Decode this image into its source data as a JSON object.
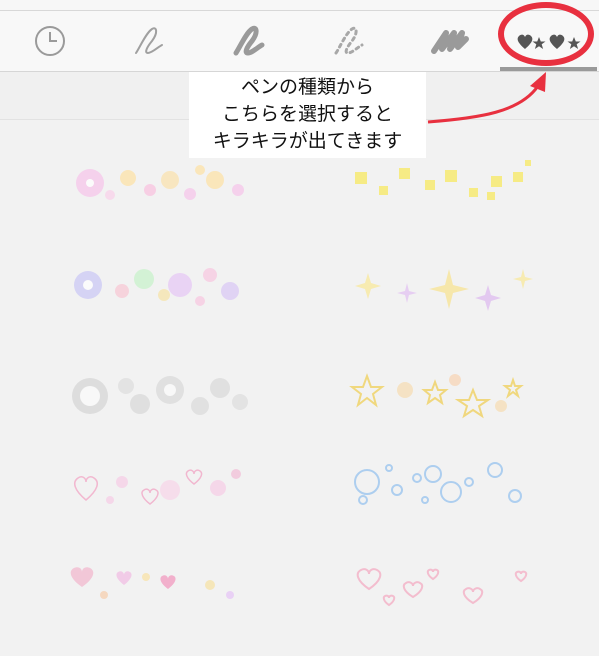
{
  "toolbar": {
    "tools": [
      {
        "icon": "clock-icon",
        "label": "history"
      },
      {
        "icon": "pen-icon",
        "label": "pen"
      },
      {
        "icon": "marker-icon",
        "label": "marker"
      },
      {
        "icon": "dotted-pen-icon",
        "label": "dotted pen"
      },
      {
        "icon": "brush-icon",
        "label": "brush"
      },
      {
        "icon": "stamp-pen-icon",
        "label": "sparkle pen"
      }
    ],
    "selected_index": 5
  },
  "callout": {
    "lines": [
      "ペンの種類から",
      "こちらを選択すると",
      "キラキラが出てきます"
    ]
  },
  "colors": {
    "annotation": "#e8303f",
    "icon": "#9a9a9a",
    "icon_selected": "#555555"
  },
  "pens": [
    {
      "name": "pink-gold-sparkle-pen"
    },
    {
      "name": "yellow-sparkle-pen"
    },
    {
      "name": "rainbow-sparkle-pen"
    },
    {
      "name": "yellow-purple-star-pen"
    },
    {
      "name": "white-glow-pen"
    },
    {
      "name": "yellow-outline-star-pen"
    },
    {
      "name": "pink-heart-sparkle-pen"
    },
    {
      "name": "blue-bubble-pen"
    },
    {
      "name": "pastel-heart-pen"
    },
    {
      "name": "pink-outline-heart-pen"
    }
  ]
}
